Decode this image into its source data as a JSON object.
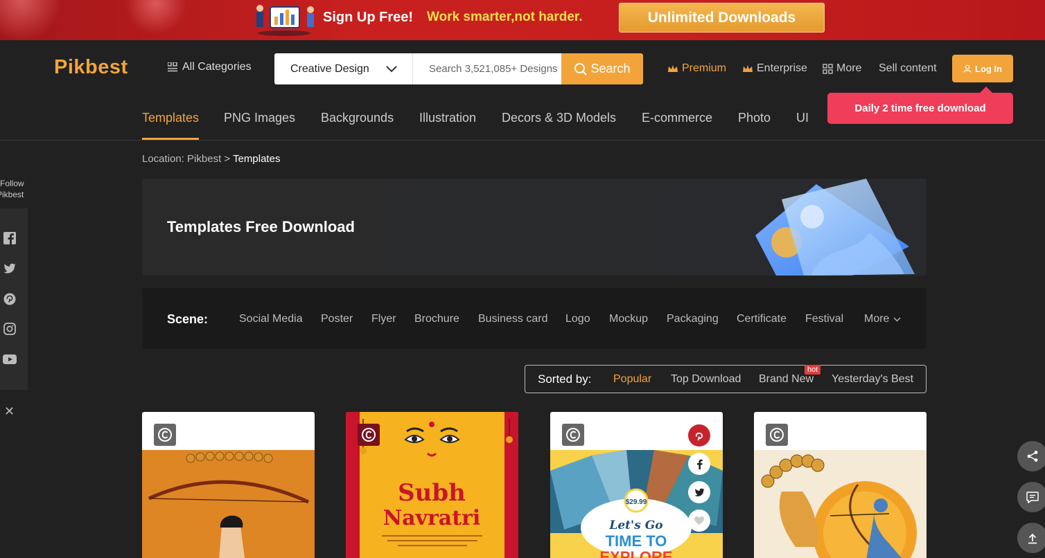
{
  "promo": {
    "signup": "Sign Up Free!",
    "slogan": "Work smarter,not harder.",
    "button": "Unlimited Downloads"
  },
  "header": {
    "logo": "Pikbest",
    "all_categories": "All Categories",
    "search_type": "Creative Design",
    "search_placeholder": "Search 3,521,085+ Designs",
    "search_button": "Search",
    "premium": "Premium",
    "enterprise": "Enterprise",
    "more": "More",
    "sell": "Sell content",
    "login": "Log In",
    "tooltip": "Daily 2 time free download"
  },
  "categories": [
    "Templates",
    "PNG Images",
    "Backgrounds",
    "Illustration",
    "Decors & 3D Models",
    "E-commerce",
    "Photo",
    "UI"
  ],
  "follow": {
    "line1": "Follow",
    "line2": "Pikbest"
  },
  "breadcrumb": {
    "prefix": "Location: Pikbest >",
    "current": "Templates"
  },
  "hero": {
    "title": "Templates Free Download"
  },
  "scene": {
    "label": "Scene:",
    "tags": [
      "Social Media",
      "Poster",
      "Flyer",
      "Brochure",
      "Business card",
      "Logo",
      "Mockup",
      "Packaging",
      "Certificate",
      "Festival",
      "More"
    ]
  },
  "sort": {
    "label": "Sorted by:",
    "options": [
      "Popular",
      "Top Download",
      "Brand New",
      "Yesterday's Best"
    ],
    "hot_badge": "hot"
  },
  "cards": [
    {
      "title_text": ""
    },
    {
      "title_text": "Subh Navratri"
    },
    {
      "title_text": "Let's Go TIME TO EXPLORE",
      "price": "$29.99"
    },
    {
      "title_text": ""
    }
  ],
  "colors": {
    "accent": "#f2a43a",
    "tooltip": "#ef3d5a",
    "banner": "#c71f1e"
  }
}
